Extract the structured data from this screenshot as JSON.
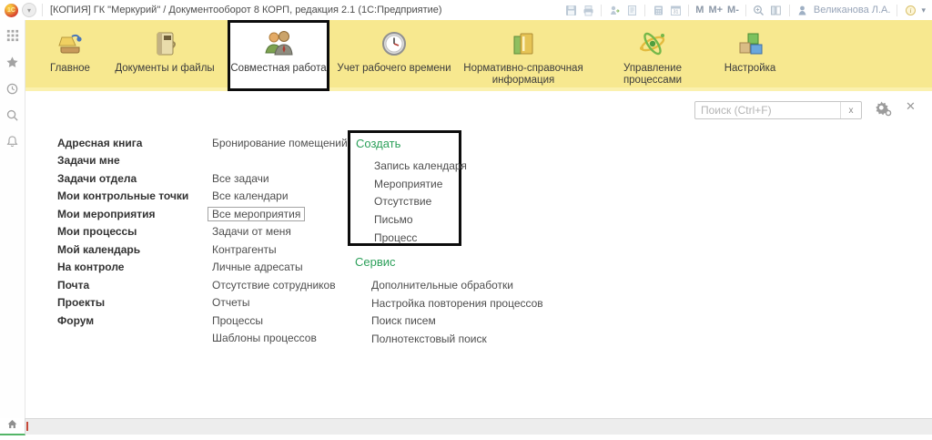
{
  "titlebar": {
    "app_title": "[КОПИЯ] ГК \"Меркурий\" / Документооборот 8 КОРП, редакция 2.1   (1С:Предприятие)",
    "user_name": "Великанова Л.А.",
    "m": "M",
    "m_plus": "M+",
    "m_minus": "M-"
  },
  "ribbon": {
    "tabs": [
      {
        "label": "Главное"
      },
      {
        "label": "Документы и файлы"
      },
      {
        "label": "Совместная работа",
        "active": true
      },
      {
        "label": "Учет рабочего времени"
      },
      {
        "label": "Нормативно-справочная информация"
      },
      {
        "label": "Управление процессами"
      },
      {
        "label": "Настройка"
      }
    ]
  },
  "search": {
    "placeholder": "Поиск (Ctrl+F)",
    "clear_label": "x"
  },
  "content": {
    "column1": [
      "Адресная книга",
      "Задачи мне",
      "Задачи отдела",
      "Мои контрольные точки",
      "Мои мероприятия",
      "Мои процессы",
      "Мой календарь",
      "На контроле",
      "Почта",
      "Проекты",
      "Форум"
    ],
    "column2": [
      "Бронирование помещений",
      "Все задачи",
      "Все календари",
      "Все мероприятия",
      "Задачи от меня",
      "Контрагенты",
      "Личные адресаты",
      "Отсутствие сотрудников",
      "Отчеты",
      "Процессы",
      "Шаблоны процессов"
    ],
    "focused_item": "Все мероприятия",
    "create": {
      "header": "Создать",
      "items": [
        "Запись календаря",
        "Мероприятие",
        "Отсутствие",
        "Письмо",
        "Процесс"
      ]
    },
    "service": {
      "header": "Сервис",
      "items": [
        "Дополнительные обработки",
        "Настройка повторения процессов",
        "Поиск писем",
        "Полнотекстовый поиск"
      ]
    }
  },
  "glyphs": {
    "logo_text": "1С",
    "sysmenu_caret": "▾",
    "info_caret": "▾",
    "close": "✕",
    "calendar_day": "31"
  },
  "colors": {
    "ribbon_yellow": "#f7e88f",
    "section_header_green": "#2ca05a",
    "annotation_border": "#0c0c0c",
    "active_tab_bg": "#ffffff",
    "home_underline_green": "#53b567"
  }
}
